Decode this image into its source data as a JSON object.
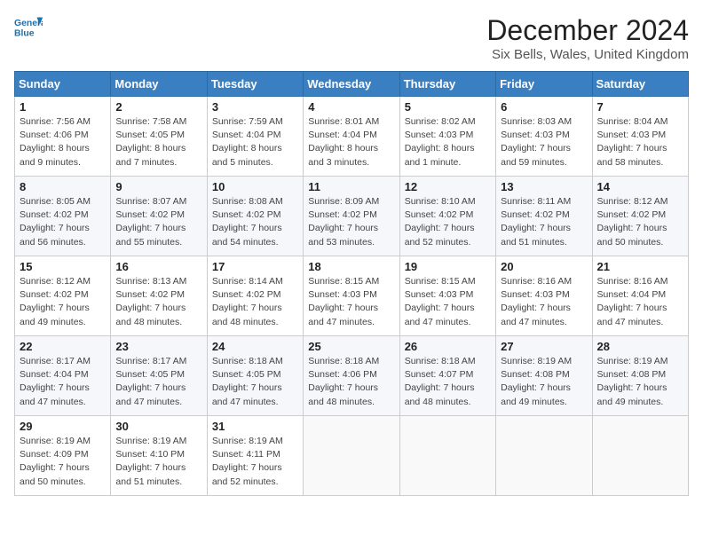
{
  "header": {
    "logo_line1": "General",
    "logo_line2": "Blue",
    "title": "December 2024",
    "subtitle": "Six Bells, Wales, United Kingdom"
  },
  "calendar": {
    "days_of_week": [
      "Sunday",
      "Monday",
      "Tuesday",
      "Wednesday",
      "Thursday",
      "Friday",
      "Saturday"
    ],
    "weeks": [
      [
        null,
        {
          "day": 2,
          "sunrise": "Sunrise: 7:58 AM",
          "sunset": "Sunset: 4:05 PM",
          "daylight": "Daylight: 8 hours and 7 minutes."
        },
        {
          "day": 3,
          "sunrise": "Sunrise: 7:59 AM",
          "sunset": "Sunset: 4:04 PM",
          "daylight": "Daylight: 8 hours and 5 minutes."
        },
        {
          "day": 4,
          "sunrise": "Sunrise: 8:01 AM",
          "sunset": "Sunset: 4:04 PM",
          "daylight": "Daylight: 8 hours and 3 minutes."
        },
        {
          "day": 5,
          "sunrise": "Sunrise: 8:02 AM",
          "sunset": "Sunset: 4:03 PM",
          "daylight": "Daylight: 8 hours and 1 minute."
        },
        {
          "day": 6,
          "sunrise": "Sunrise: 8:03 AM",
          "sunset": "Sunset: 4:03 PM",
          "daylight": "Daylight: 7 hours and 59 minutes."
        },
        {
          "day": 7,
          "sunrise": "Sunrise: 8:04 AM",
          "sunset": "Sunset: 4:03 PM",
          "daylight": "Daylight: 7 hours and 58 minutes."
        }
      ],
      [
        {
          "day": 1,
          "sunrise": "Sunrise: 7:56 AM",
          "sunset": "Sunset: 4:06 PM",
          "daylight": "Daylight: 8 hours and 9 minutes."
        },
        {
          "day": 9,
          "sunrise": "Sunrise: 8:07 AM",
          "sunset": "Sunset: 4:02 PM",
          "daylight": "Daylight: 7 hours and 55 minutes."
        },
        {
          "day": 10,
          "sunrise": "Sunrise: 8:08 AM",
          "sunset": "Sunset: 4:02 PM",
          "daylight": "Daylight: 7 hours and 54 minutes."
        },
        {
          "day": 11,
          "sunrise": "Sunrise: 8:09 AM",
          "sunset": "Sunset: 4:02 PM",
          "daylight": "Daylight: 7 hours and 53 minutes."
        },
        {
          "day": 12,
          "sunrise": "Sunrise: 8:10 AM",
          "sunset": "Sunset: 4:02 PM",
          "daylight": "Daylight: 7 hours and 52 minutes."
        },
        {
          "day": 13,
          "sunrise": "Sunrise: 8:11 AM",
          "sunset": "Sunset: 4:02 PM",
          "daylight": "Daylight: 7 hours and 51 minutes."
        },
        {
          "day": 14,
          "sunrise": "Sunrise: 8:12 AM",
          "sunset": "Sunset: 4:02 PM",
          "daylight": "Daylight: 7 hours and 50 minutes."
        }
      ],
      [
        {
          "day": 8,
          "sunrise": "Sunrise: 8:05 AM",
          "sunset": "Sunset: 4:02 PM",
          "daylight": "Daylight: 7 hours and 56 minutes."
        },
        {
          "day": 16,
          "sunrise": "Sunrise: 8:13 AM",
          "sunset": "Sunset: 4:02 PM",
          "daylight": "Daylight: 7 hours and 48 minutes."
        },
        {
          "day": 17,
          "sunrise": "Sunrise: 8:14 AM",
          "sunset": "Sunset: 4:02 PM",
          "daylight": "Daylight: 7 hours and 48 minutes."
        },
        {
          "day": 18,
          "sunrise": "Sunrise: 8:15 AM",
          "sunset": "Sunset: 4:03 PM",
          "daylight": "Daylight: 7 hours and 47 minutes."
        },
        {
          "day": 19,
          "sunrise": "Sunrise: 8:15 AM",
          "sunset": "Sunset: 4:03 PM",
          "daylight": "Daylight: 7 hours and 47 minutes."
        },
        {
          "day": 20,
          "sunrise": "Sunrise: 8:16 AM",
          "sunset": "Sunset: 4:03 PM",
          "daylight": "Daylight: 7 hours and 47 minutes."
        },
        {
          "day": 21,
          "sunrise": "Sunrise: 8:16 AM",
          "sunset": "Sunset: 4:04 PM",
          "daylight": "Daylight: 7 hours and 47 minutes."
        }
      ],
      [
        {
          "day": 15,
          "sunrise": "Sunrise: 8:12 AM",
          "sunset": "Sunset: 4:02 PM",
          "daylight": "Daylight: 7 hours and 49 minutes."
        },
        {
          "day": 23,
          "sunrise": "Sunrise: 8:17 AM",
          "sunset": "Sunset: 4:05 PM",
          "daylight": "Daylight: 7 hours and 47 minutes."
        },
        {
          "day": 24,
          "sunrise": "Sunrise: 8:18 AM",
          "sunset": "Sunset: 4:05 PM",
          "daylight": "Daylight: 7 hours and 47 minutes."
        },
        {
          "day": 25,
          "sunrise": "Sunrise: 8:18 AM",
          "sunset": "Sunset: 4:06 PM",
          "daylight": "Daylight: 7 hours and 48 minutes."
        },
        {
          "day": 26,
          "sunrise": "Sunrise: 8:18 AM",
          "sunset": "Sunset: 4:07 PM",
          "daylight": "Daylight: 7 hours and 48 minutes."
        },
        {
          "day": 27,
          "sunrise": "Sunrise: 8:19 AM",
          "sunset": "Sunset: 4:08 PM",
          "daylight": "Daylight: 7 hours and 49 minutes."
        },
        {
          "day": 28,
          "sunrise": "Sunrise: 8:19 AM",
          "sunset": "Sunset: 4:08 PM",
          "daylight": "Daylight: 7 hours and 49 minutes."
        }
      ],
      [
        {
          "day": 22,
          "sunrise": "Sunrise: 8:17 AM",
          "sunset": "Sunset: 4:04 PM",
          "daylight": "Daylight: 7 hours and 47 minutes."
        },
        {
          "day": 30,
          "sunrise": "Sunrise: 8:19 AM",
          "sunset": "Sunset: 4:10 PM",
          "daylight": "Daylight: 7 hours and 51 minutes."
        },
        {
          "day": 31,
          "sunrise": "Sunrise: 8:19 AM",
          "sunset": "Sunset: 4:11 PM",
          "daylight": "Daylight: 7 hours and 52 minutes."
        },
        null,
        null,
        null,
        null
      ],
      [
        {
          "day": 29,
          "sunrise": "Sunrise: 8:19 AM",
          "sunset": "Sunset: 4:09 PM",
          "daylight": "Daylight: 7 hours and 50 minutes."
        },
        null,
        null,
        null,
        null,
        null,
        null
      ]
    ]
  }
}
